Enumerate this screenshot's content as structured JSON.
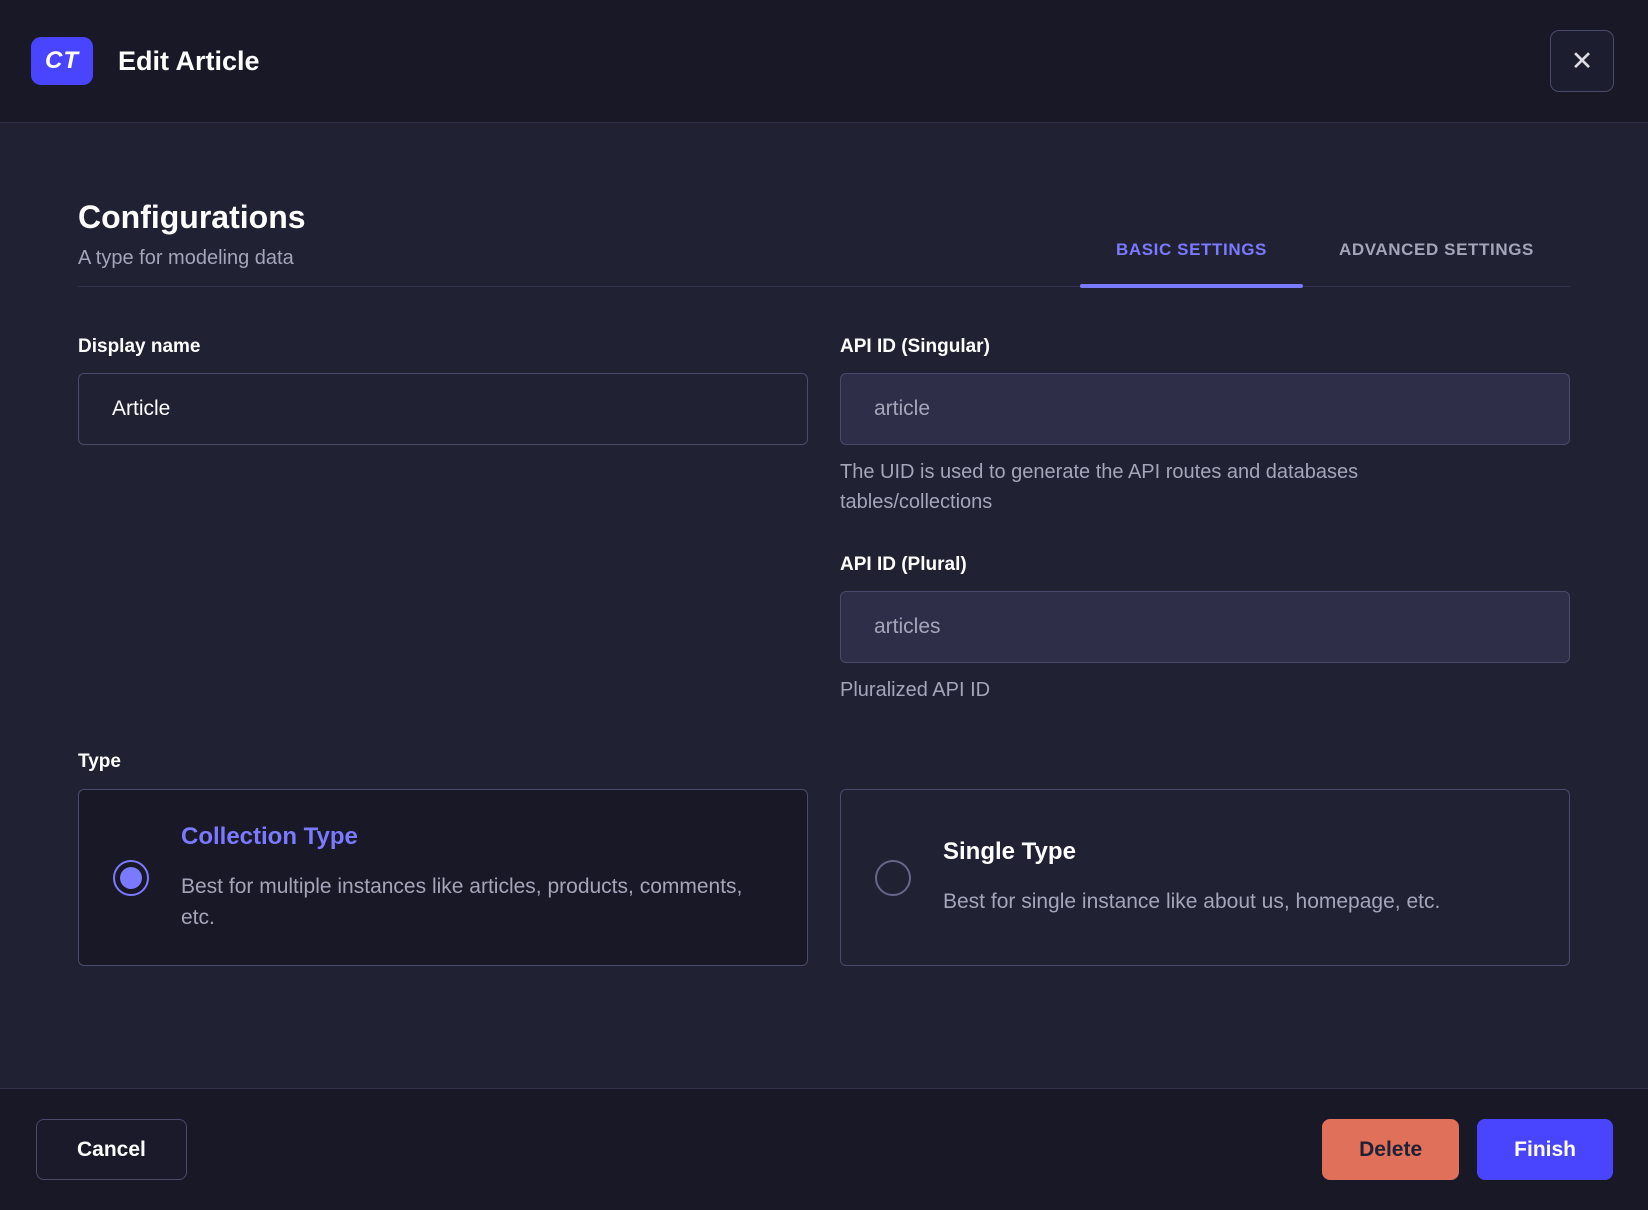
{
  "header": {
    "badge": "CT",
    "title": "Edit Article",
    "close_icon": "✕"
  },
  "section": {
    "title": "Configurations",
    "subtitle": "A type for modeling data",
    "tabs": [
      {
        "label": "BASIC SETTINGS",
        "active": true
      },
      {
        "label": "ADVANCED SETTINGS",
        "active": false
      }
    ]
  },
  "form": {
    "display_name": {
      "label": "Display name",
      "value": "Article"
    },
    "api_id_singular": {
      "label": "API ID (Singular)",
      "value": "article",
      "hint": "The UID is used to generate the API routes and databases tables/collections"
    },
    "api_id_plural": {
      "label": "API ID (Plural)",
      "value": "articles",
      "hint": "Pluralized API ID"
    },
    "type": {
      "label": "Type",
      "options": [
        {
          "title": "Collection Type",
          "description": "Best for multiple instances like articles, products, comments, etc.",
          "selected": true
        },
        {
          "title": "Single Type",
          "description": "Best for single instance like about us, homepage, etc.",
          "selected": false
        }
      ]
    }
  },
  "footer": {
    "cancel_label": "Cancel",
    "delete_label": "Delete",
    "finish_label": "Finish"
  },
  "colors": {
    "primary": "#4945ff",
    "primary_light": "#7b79ff",
    "danger": "#e0705a",
    "surface": "#212134",
    "surface_dark": "#181826",
    "border": "#4a4a6a",
    "text_muted": "#a5a5ba"
  }
}
